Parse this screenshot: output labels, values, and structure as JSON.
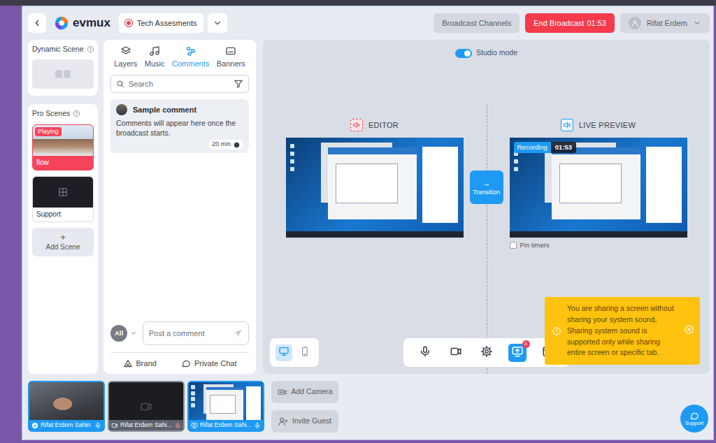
{
  "app": {
    "logo": "evmux",
    "project": "Tech Assesments",
    "recording": true
  },
  "header": {
    "channels_button": "Broadcast Channels",
    "end_button": {
      "label": "End Broadcast",
      "timer": "01:53"
    },
    "user": "Rifat Erdem"
  },
  "scenes": {
    "dynamic": {
      "title": "Dynamic Scene"
    },
    "pro": {
      "title": "Pro Scenes",
      "items": [
        {
          "label": "flow",
          "badge": "Playing",
          "selected": true,
          "kind": "photo"
        },
        {
          "label": "Support",
          "selected": false,
          "kind": "grid"
        }
      ],
      "add_symbol": "+",
      "add": "Add Scene"
    }
  },
  "panel": {
    "tabs": [
      {
        "label": "Layers",
        "selected": false
      },
      {
        "label": "Music",
        "selected": false
      },
      {
        "label": "Comments",
        "selected": true
      },
      {
        "label": "Banners",
        "selected": false
      }
    ],
    "search": {
      "placeholder": "Search"
    },
    "comments": [
      {
        "author": "Sample comment",
        "text": "Comments will appear here once the broadcast starts.",
        "age": "20 min"
      }
    ],
    "audience": "All",
    "composer": {
      "placeholder": "Post a comment"
    },
    "buttons": [
      "Brand",
      "Private Chat"
    ]
  },
  "stage": {
    "studio_mode": {
      "label": "Studio mode",
      "on": true
    },
    "editor": {
      "label": "EDITOR",
      "muted": true
    },
    "live": {
      "label": "LIVE PREVIEW",
      "muted": false,
      "badge": "Recording",
      "timer": "01:53"
    },
    "transition": {
      "symbol": "→",
      "label": "Transition"
    },
    "pin_timers": {
      "label": "Pin timers",
      "checked": false
    },
    "views": [
      {
        "kind": "desktop",
        "selected": true
      },
      {
        "kind": "mobile",
        "selected": false
      }
    ],
    "toolbar": [
      {
        "kind": "mic",
        "selected": false
      },
      {
        "kind": "camera",
        "selected": false
      },
      {
        "kind": "settings",
        "selected": false
      },
      {
        "kind": "screen",
        "selected": true
      },
      {
        "kind": "media",
        "selected": false
      }
    ],
    "toast": {
      "text": "You are sharing a screen without sharing your system sound, Sharing system sound is supported only while sharing entire screen or specific tab."
    }
  },
  "sources": [
    {
      "label": "Rifat Erdem Sahin",
      "kind": "photo",
      "selected": true,
      "muted": false
    },
    {
      "label": "Rifat Erdem Sahi...",
      "kind": "blank",
      "selected": false,
      "muted": true
    },
    {
      "label": "Rifat Erdem Sahi...",
      "kind": "screen",
      "selected": true,
      "muted": false
    }
  ],
  "actions": [
    "Add Camera",
    "Invite Guest"
  ],
  "support": "Support"
}
